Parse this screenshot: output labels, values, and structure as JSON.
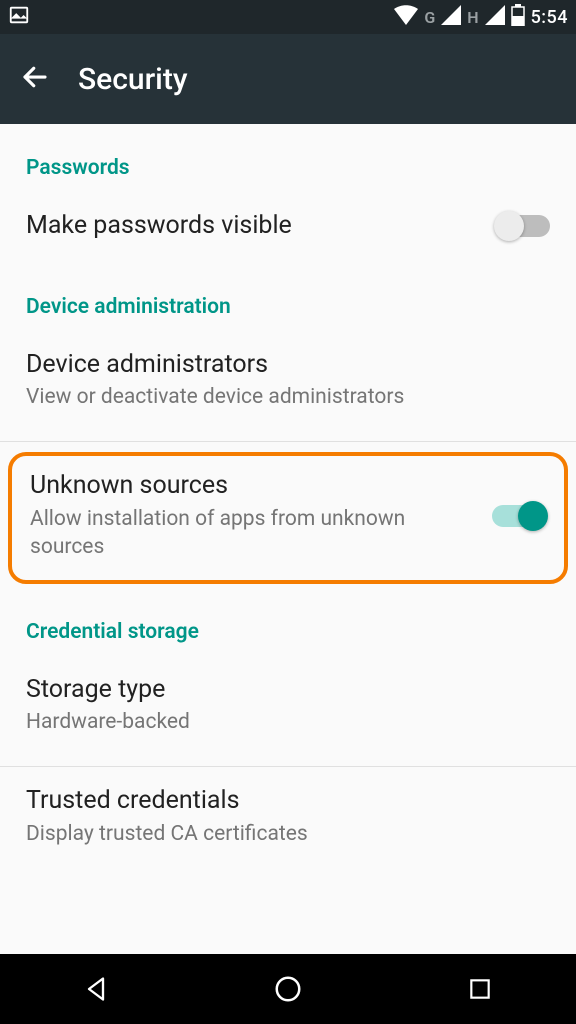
{
  "statusbar": {
    "net1_label": "G",
    "net2_label": "H",
    "time": "5:54"
  },
  "appbar": {
    "title": "Security"
  },
  "sections": {
    "passwords": {
      "header": "Passwords",
      "item_visible": {
        "title": "Make passwords visible",
        "checked": false
      }
    },
    "device_admin": {
      "header": "Device administration",
      "administrators": {
        "title": "Device administrators",
        "sub": "View or deactivate device administrators"
      },
      "unknown_sources": {
        "title": "Unknown sources",
        "sub": "Allow installation of apps from unknown sources",
        "checked": true
      }
    },
    "credential_storage": {
      "header": "Credential storage",
      "storage_type": {
        "title": "Storage type",
        "sub": "Hardware-backed"
      },
      "trusted": {
        "title": "Trusted credentials",
        "sub": "Display trusted CA certificates"
      }
    }
  }
}
